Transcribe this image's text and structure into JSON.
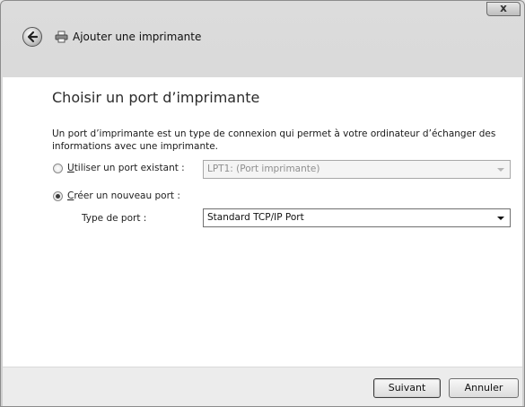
{
  "window": {
    "title": "Ajouter une imprimante",
    "close_label": "x"
  },
  "page": {
    "heading": "Choisir un port d’imprimante",
    "description": "Un port d’imprimante est un type de connexion qui permet à votre ordinateur d’échanger des informations avec une imprimante."
  },
  "existing_port": {
    "label_prefix": "",
    "label_accel": "U",
    "label_rest": "tiliser un port existant :",
    "selected": false,
    "dropdown_value": "LPT1: (Port imprimante)"
  },
  "new_port": {
    "label_accel": "C",
    "label_rest": "réer un nouveau port :",
    "selected": true,
    "type_label": "Type de port :",
    "dropdown_value": "Standard TCP/IP Port"
  },
  "footer": {
    "next_label": "Suivant",
    "cancel_label": "Annuler"
  }
}
